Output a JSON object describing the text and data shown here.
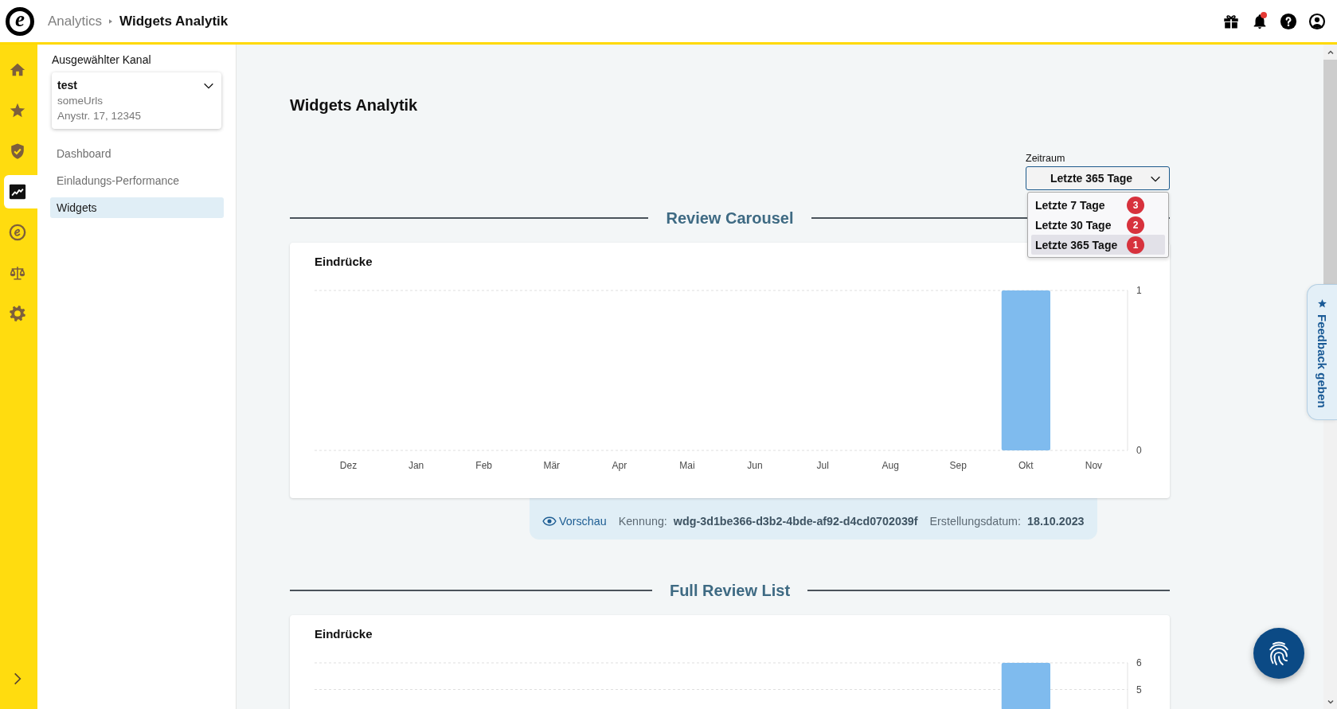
{
  "header": {
    "logo": "e",
    "breadcrumb": [
      {
        "label": "Analytics",
        "current": false
      },
      {
        "label": "Widgets Analytik",
        "current": true
      }
    ],
    "unread_notifications": true
  },
  "rail": {
    "items": [
      {
        "kind": "home",
        "selected": false
      },
      {
        "kind": "star",
        "selected": false
      },
      {
        "kind": "shield",
        "selected": false
      },
      {
        "kind": "chart",
        "selected": true
      },
      {
        "kind": "brand",
        "selected": false
      },
      {
        "kind": "scales",
        "selected": false
      },
      {
        "kind": "gear",
        "selected": false
      }
    ]
  },
  "sidebar": {
    "channel_label": "Ausgewählter Kanal",
    "channel": {
      "name": "test",
      "url": "someUrls",
      "address": "Anystr. 17, 12345"
    },
    "items": [
      {
        "label": "Dashboard",
        "selected": false
      },
      {
        "label": "Einladungs-Performance",
        "selected": false
      },
      {
        "label": "Widgets",
        "selected": true
      }
    ]
  },
  "page": {
    "title": "Widgets Analytik"
  },
  "period": {
    "label": "Zeitraum",
    "value": "Letzte 365 Tage",
    "expanded": true,
    "options": [
      {
        "label": "Letzte 7 Tage",
        "badge": "3",
        "selected": false
      },
      {
        "label": "Letzte 30 Tage",
        "badge": "2",
        "selected": false
      },
      {
        "label": "Letzte 365 Tage",
        "badge": "1",
        "selected": true
      }
    ]
  },
  "sections": [
    {
      "title": "Review Carousel",
      "card_title": "Eindrücke",
      "chart_data": {
        "type": "bar",
        "categories": [
          "Dez",
          "Jan",
          "Feb",
          "Mär",
          "Apr",
          "Mai",
          "Jun",
          "Jul",
          "Aug",
          "Sep",
          "Okt",
          "Nov"
        ],
        "values": [
          0,
          0,
          0,
          0,
          0,
          0,
          0,
          0,
          0,
          0,
          1,
          0
        ],
        "ylim": [
          0,
          1
        ],
        "yticks": [
          0,
          1
        ]
      },
      "info": {
        "preview": "Vorschau",
        "id_label": "Kennung:",
        "id": "wdg-3d1be366-d3b2-4bde-af92-d4cd0702039f",
        "date_label": "Erstellungsdatum:",
        "date": "18.10.2023"
      }
    },
    {
      "title": "Full Review List",
      "card_title": "Eindrücke",
      "chart_data": {
        "type": "bar",
        "values": [
          null,
          null,
          null,
          null,
          null,
          null,
          null,
          null,
          null,
          null,
          6,
          null
        ],
        "ylim": [
          4.24,
          6
        ],
        "yticks": [
          5,
          6
        ]
      }
    }
  ],
  "feedback": {
    "label": "Feedback geben"
  }
}
